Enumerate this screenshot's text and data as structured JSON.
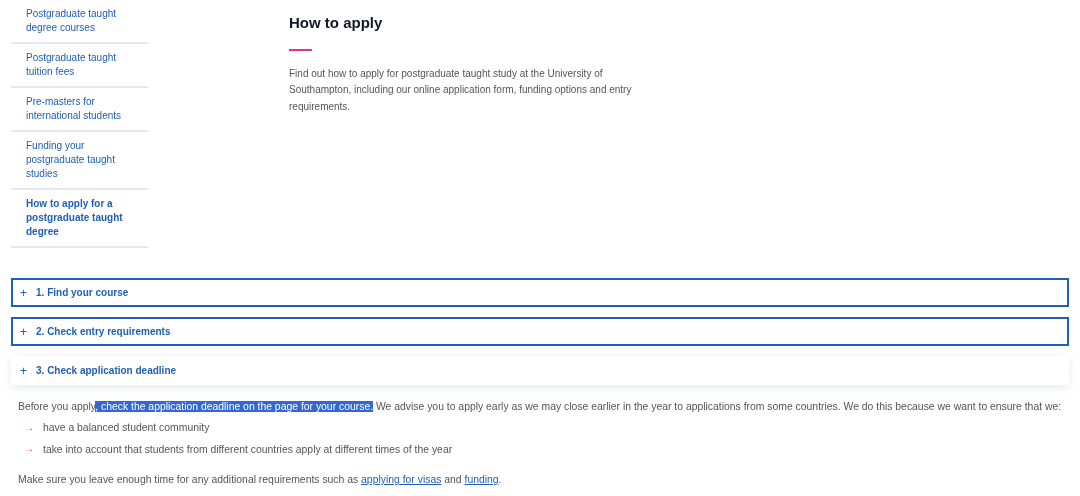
{
  "sidebar": {
    "items": [
      {
        "label": "Postgraduate taught degree courses",
        "selected": false
      },
      {
        "label": "Postgraduate taught tuition fees",
        "selected": false
      },
      {
        "label": "Pre-masters for international students",
        "selected": false
      },
      {
        "label": "Funding your postgraduate taught studies",
        "selected": false
      },
      {
        "label": "How to apply for a postgraduate taught degree",
        "selected": true
      }
    ]
  },
  "header": {
    "title": "How to apply",
    "intro": "Find out how to apply for postgraduate taught study at the University of Southampton, including our online application form, funding options and entry requirements."
  },
  "accordion": [
    {
      "icon": "+",
      "label": "1. Find your course",
      "focused": true
    },
    {
      "icon": "+",
      "label": "2. Check entry requirements",
      "focused": true
    },
    {
      "icon": "+",
      "label": "3. Check application deadline",
      "focused": false
    }
  ],
  "content": {
    "paragraph": [
      {
        "text": "Before you apply",
        "selected": false
      },
      {
        "text": ", check the application deadline on the page for your course.",
        "selected": true
      },
      {
        "text": " We advise you to apply early as we may close earlier in the year to applications from some countries. We do this because we want to ensure that we:",
        "selected": false
      }
    ],
    "bullets": [
      {
        "marker": "→",
        "text": "have a balanced student community"
      },
      {
        "marker": "→",
        "text": "take into account that students from different countries apply at different times of the year"
      }
    ],
    "note": [
      {
        "kind": "text",
        "text": "Make sure you leave enough time for any additional requirements such as "
      },
      {
        "kind": "link",
        "text": "applying for visas"
      },
      {
        "kind": "text",
        "text": " and "
      },
      {
        "kind": "link",
        "text": "funding"
      },
      {
        "kind": "text",
        "text": "."
      }
    ]
  }
}
